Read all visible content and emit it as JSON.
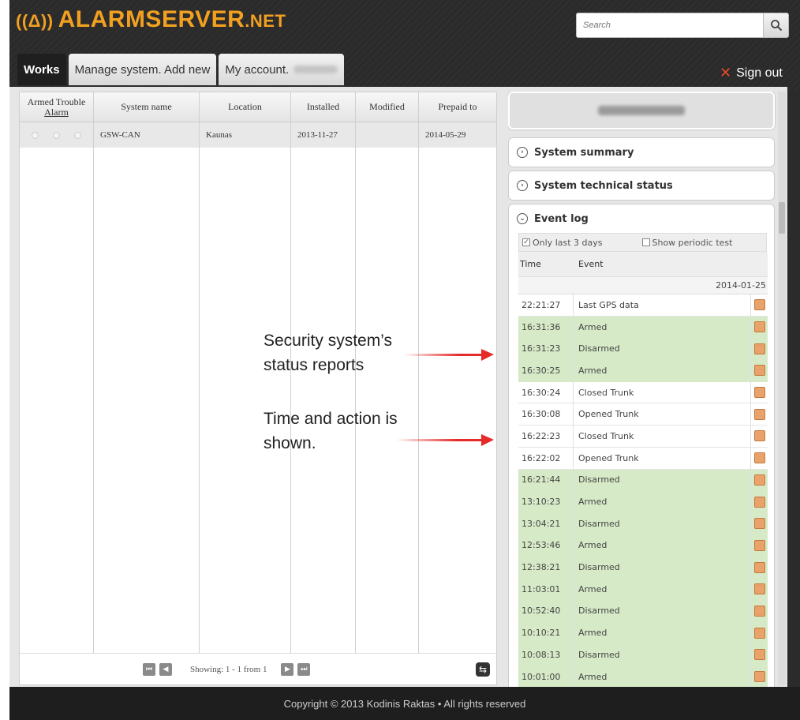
{
  "logo": {
    "icon": "((Δ))",
    "name": "ALARMSERVER",
    "tld": ".NET"
  },
  "search": {
    "placeholder": "Search"
  },
  "tabs": [
    {
      "label": "Works"
    },
    {
      "label": "Manage system. Add new"
    },
    {
      "label": "My account."
    }
  ],
  "sign_out": "Sign out",
  "grid": {
    "headers": {
      "armed": "Armed",
      "trouble": "Trouble",
      "alarm": "Alarm",
      "name": "System name",
      "location": "Location",
      "installed": "Installed",
      "modified": "Modified",
      "prepaid": "Prepaid to"
    },
    "row": {
      "name": "GSW-CAN",
      "location": "Kaunas",
      "installed": "2013-11-27",
      "modified": "",
      "prepaid": "2014-05-29"
    }
  },
  "pager": {
    "text": "Showing: 1 - 1 from 1"
  },
  "right": {
    "summary": "System summary",
    "technical": "System technical status",
    "event_log": "Event log",
    "filter_last3": "Only last 3 days",
    "filter_periodic": "Show periodic test",
    "col_time": "Time",
    "col_event": "Event",
    "date": "2014-01-25",
    "events": [
      {
        "time": "22:21:27",
        "event": "Last GPS data",
        "green": false
      },
      {
        "time": "16:31:36",
        "event": "Armed",
        "green": true
      },
      {
        "time": "16:31:23",
        "event": "Disarmed",
        "green": true
      },
      {
        "time": "16:30:25",
        "event": "Armed",
        "green": true
      },
      {
        "time": "16:30:24",
        "event": "Closed Trunk",
        "green": false
      },
      {
        "time": "16:30:08",
        "event": "Opened Trunk",
        "green": false
      },
      {
        "time": "16:22:23",
        "event": "Closed Trunk",
        "green": false
      },
      {
        "time": "16:22:02",
        "event": "Opened Trunk",
        "green": false
      },
      {
        "time": "16:21:44",
        "event": "Disarmed",
        "green": true
      },
      {
        "time": "13:10:23",
        "event": "Armed",
        "green": true
      },
      {
        "time": "13:04:21",
        "event": "Disarmed",
        "green": true
      },
      {
        "time": "12:53:46",
        "event": "Armed",
        "green": true
      },
      {
        "time": "12:38:21",
        "event": "Disarmed",
        "green": true
      },
      {
        "time": "11:03:01",
        "event": "Armed",
        "green": true
      },
      {
        "time": "10:52:40",
        "event": "Disarmed",
        "green": true
      },
      {
        "time": "10:10:21",
        "event": "Armed",
        "green": true
      },
      {
        "time": "10:08:13",
        "event": "Disarmed",
        "green": true
      },
      {
        "time": "10:01:00",
        "event": "Armed",
        "green": true
      }
    ]
  },
  "annotations": {
    "a1_line1": "Security system’s",
    "a1_line2": "status reports",
    "a2_line1": "Time and action is",
    "a2_line2": "shown."
  },
  "footer": "Copyright © 2013 Kodinis Raktas • All rights reserved",
  "colors": {
    "brand": "#f2a020",
    "event_green": "#d6eac7",
    "annotation_arrow": "#e52a2a"
  }
}
